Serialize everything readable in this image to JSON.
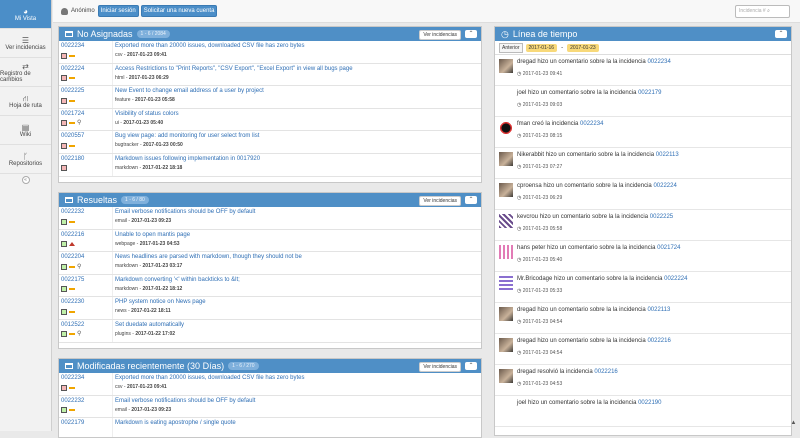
{
  "sidebar": {
    "items": [
      {
        "label": "Mi Vista",
        "icon": "dashboard-icon"
      },
      {
        "label": "Ver incidencias",
        "icon": "list-icon"
      },
      {
        "label": "Registro de cambios",
        "icon": "retweet-icon"
      },
      {
        "label": "Hoja de ruta",
        "icon": "road-icon"
      },
      {
        "label": "Wiki",
        "icon": "book-icon"
      },
      {
        "label": "Repositorios",
        "icon": "branch-icon"
      }
    ]
  },
  "topbar": {
    "user": "Anónimo",
    "login": "Iniciar sesión",
    "signup": "Solicitar una nueva cuenta",
    "search_placeholder": "Incidencia #"
  },
  "panels": {
    "unassigned": {
      "title": "No Asignadas",
      "badge": "1 - 6 / 2084",
      "view_button": "Ver incidencias",
      "rows": [
        {
          "id": "0022234",
          "summary": "Exported more than 20000 issues, downloaded CSV file has zero bytes",
          "category": "csv",
          "date": "2017-01-23 09:41",
          "status": "red",
          "priority": "normal",
          "attachment": false
        },
        {
          "id": "0022224",
          "summary": "Access Restrictions to \"Print Reports\", \"CSV Export\", \"Excel Export\" in view all bugs page",
          "category": "html",
          "date": "2017-01-23 06:29",
          "status": "red",
          "priority": "normal",
          "attachment": false
        },
        {
          "id": "0022225",
          "summary": "New Event to change email address of a user by project",
          "category": "feature",
          "date": "2017-01-23 05:58",
          "status": "red",
          "priority": "normal",
          "attachment": false
        },
        {
          "id": "0021724",
          "summary": "Visibility of status colors",
          "category": "ui",
          "date": "2017-01-23 05:40",
          "status": "red",
          "priority": "normal",
          "attachment": true
        },
        {
          "id": "0020557",
          "summary": "Bug view page: add monitoring for user select from list",
          "category": "bugtracker",
          "date": "2017-01-23 00:50",
          "status": "red",
          "priority": "normal",
          "attachment": false
        },
        {
          "id": "0022180",
          "summary": "Markdown issues following implementation in 0017920",
          "category": "markdown",
          "date": "2017-01-22 18:18",
          "status": "red",
          "priority": "none",
          "attachment": false
        }
      ]
    },
    "resolved": {
      "title": "Resueltas",
      "badge": "1 - 6 / 80",
      "view_button": "Ver incidencias",
      "rows": [
        {
          "id": "0022232",
          "summary": "Email verbose notifications should be OFF by default",
          "category": "email",
          "date": "2017-01-23 09:23",
          "status": "green",
          "priority": "normal",
          "attachment": false
        },
        {
          "id": "0022216",
          "summary": "Unable to open mantis page",
          "category": "webpage",
          "date": "2017-01-23 04:53",
          "status": "green",
          "priority": "high",
          "attachment": false
        },
        {
          "id": "0022204",
          "summary": "News headlines are parsed with markdown, though they should not be",
          "category": "markdown",
          "date": "2017-01-23 03:17",
          "status": "green",
          "priority": "normal",
          "attachment": true
        },
        {
          "id": "0022175",
          "summary": "Markdown converting '<' within backticks to &lt;",
          "category": "markdown",
          "date": "2017-01-22 18:12",
          "status": "green",
          "priority": "normal",
          "attachment": false
        },
        {
          "id": "0022230",
          "summary": "PHP system notice on News page",
          "category": "news",
          "date": "2017-01-22 18:11",
          "status": "green",
          "priority": "normal",
          "attachment": false
        },
        {
          "id": "0012522",
          "summary": "Set duedate automatically",
          "category": "plugins",
          "date": "2017-01-22 17:02",
          "status": "green",
          "priority": "normal",
          "attachment": true
        }
      ]
    },
    "recent": {
      "title": "Modificadas recientemente (30 Días)",
      "badge": "1 - 6 / 270",
      "view_button": "Ver incidencias",
      "rows": [
        {
          "id": "0022234",
          "summary": "Exported more than 20000 issues, downloaded CSV file has zero bytes",
          "category": "csv",
          "date": "2017-01-23 09:41",
          "status": "red",
          "priority": "normal",
          "attachment": false
        },
        {
          "id": "0022232",
          "summary": "Email verbose notifications should be OFF by default",
          "category": "email",
          "date": "2017-01-23 09:23",
          "status": "green",
          "priority": "normal",
          "attachment": false
        },
        {
          "id": "0022179",
          "summary": "Markdown is eating apostrophe / single quote",
          "category": "",
          "date": "",
          "status": "",
          "priority": "",
          "attachment": false
        }
      ]
    }
  },
  "timeline": {
    "title": "Línea de tiempo",
    "prev": "Anterior",
    "date_from": "2017-01-16",
    "date_to": "2017-01-23",
    "entries": [
      {
        "user": "dregad",
        "action": "hizo un comentario sobre la la incidencia",
        "issue": "0022234",
        "date": "2017-01-23 09:41",
        "avatar": "photo"
      },
      {
        "user": "joel",
        "action": "hizo un comentario sobre la la incidencia",
        "issue": "0022179",
        "date": "2017-01-23 09:03",
        "avatar": "none"
      },
      {
        "user": "fman",
        "action": "creó la incidencia",
        "issue": "0022234",
        "date": "2017-01-23 08:15",
        "avatar": "ninja"
      },
      {
        "user": "Nikerabbit",
        "action": "hizo un comentario sobre la la incidencia",
        "issue": "0022113",
        "date": "2017-01-23 07:27",
        "avatar": "photo"
      },
      {
        "user": "cproensa",
        "action": "hizo un comentario sobre la la incidencia",
        "issue": "0022224",
        "date": "2017-01-23 06:29",
        "avatar": "photo"
      },
      {
        "user": "kevcrou",
        "action": "hizo un comentario sobre la la incidencia",
        "issue": "0022225",
        "date": "2017-01-23 05:58",
        "avatar": "pattern"
      },
      {
        "user": "hans peter",
        "action": "hizo un comentario sobre la la incidencia",
        "issue": "0021724",
        "date": "2017-01-23 05:40",
        "avatar": "pink"
      },
      {
        "user": "Mr.Bricodage",
        "action": "hizo un comentario sobre la la incidencia",
        "issue": "0022224",
        "date": "2017-01-23 05:33",
        "avatar": "purple"
      },
      {
        "user": "dregad",
        "action": "hizo un comentario sobre la la incidencia",
        "issue": "0022113",
        "date": "2017-01-23 04:54",
        "avatar": "photo"
      },
      {
        "user": "dregad",
        "action": "hizo un comentario sobre la la incidencia",
        "issue": "0022216",
        "date": "2017-01-23 04:54",
        "avatar": "photo"
      },
      {
        "user": "dregad",
        "action": "resolvió la incidencia",
        "issue": "0022216",
        "date": "2017-01-23 04:53",
        "avatar": "photo"
      },
      {
        "user": "joel",
        "action": "hizo un comentario sobre la la incidencia",
        "issue": "0022190",
        "date": "",
        "avatar": "none"
      }
    ]
  },
  "colors": {
    "accent": "#4f8fc6",
    "status_new": "#f4b7b7",
    "status_resolved": "#bff0a8",
    "priority": "#f0a500"
  }
}
